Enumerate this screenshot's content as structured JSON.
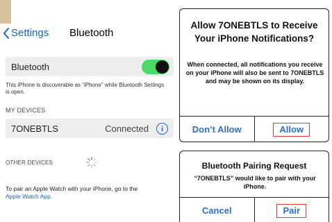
{
  "nav": {
    "back_label": "Settings",
    "title": "Bluetooth"
  },
  "bluetooth_row": {
    "label": "Bluetooth",
    "toggle_on": true
  },
  "discover_text": "This iPhone is discoverable as “iPhone” while Bluetooth Settings is open.",
  "my_devices": {
    "header": "MY DEVICES",
    "devices": [
      {
        "name": "7ONEBTLS",
        "status": "Connected"
      }
    ]
  },
  "other_devices": {
    "header": "OTHER DEVICES"
  },
  "apple_watch": {
    "text": "To pair an Apple Watch with your iPhone, go to the",
    "link": "Apple Watch App."
  },
  "notification_dialog": {
    "title": "Allow 7ONEBTLS to Receive Your iPhone Notifications?",
    "body": "When connected, all notifications you receive on your iPhone will also be sent to 7ONEBTLS and may be shown on its display.",
    "deny_label": "Don’t Allow",
    "allow_label": "Allow"
  },
  "pairing_dialog": {
    "title": "Bluetooth Pairing Request",
    "body": "“7ONEBTLS” would like to pair with your iPhone.",
    "cancel_label": "Cancel",
    "pair_label": "Pair"
  },
  "colors": {
    "accent": "#1a63d6",
    "toggle_on": "#4bd865",
    "highlight": "#e53935"
  }
}
